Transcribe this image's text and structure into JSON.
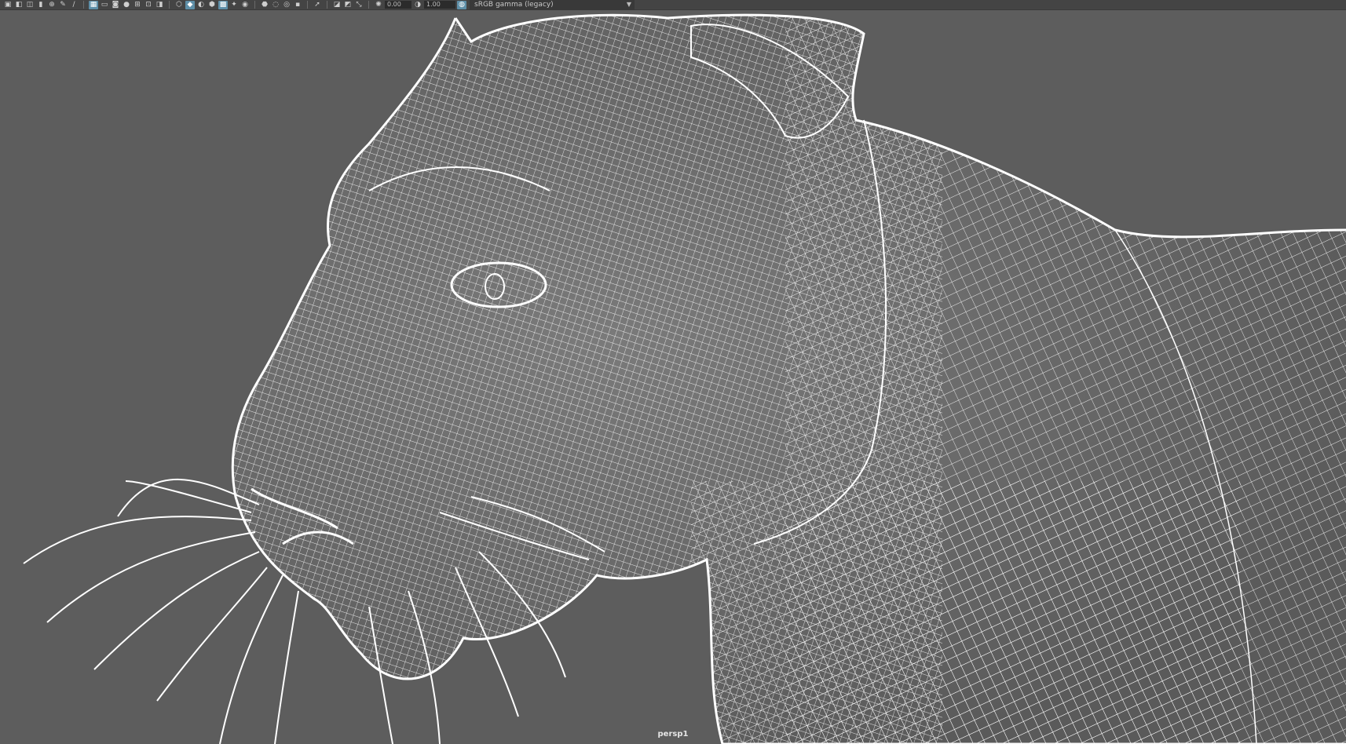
{
  "toolbar": {
    "exposure_value": "0.00",
    "gamma_value": "1.00",
    "color_space": "sRGB gamma (legacy)",
    "icons": [
      "select-camera-icon",
      "camera-attributes-icon",
      "bookmark-icon",
      "image-plane-icon",
      "2d-pan-zoom-icon",
      "grease-pencil-icon",
      "grid-icon",
      "film-gate-icon",
      "resolution-gate-icon",
      "gate-mask-icon",
      "field-chart-icon",
      "safe-action-icon",
      "safe-title-icon",
      "wireframe-icon",
      "smooth-shade-icon",
      "default-material-icon",
      "xray-icon",
      "wireframe-on-shaded-icon",
      "textured-icon",
      "use-all-lights-icon",
      "shadows-icon",
      "ambient-occlusion-icon",
      "motion-blur-icon",
      "anti-aliasing-icon",
      "depth-of-field-icon",
      "isolate-select-icon",
      "xray-joints-icon",
      "exposure-icon",
      "gamma-icon",
      "color-management-icon"
    ]
  },
  "viewport": {
    "camera_label": "persp1",
    "background_color": "#5d5d5d",
    "wire_color": "#ffffff",
    "subject": "panther-head-wireframe"
  }
}
